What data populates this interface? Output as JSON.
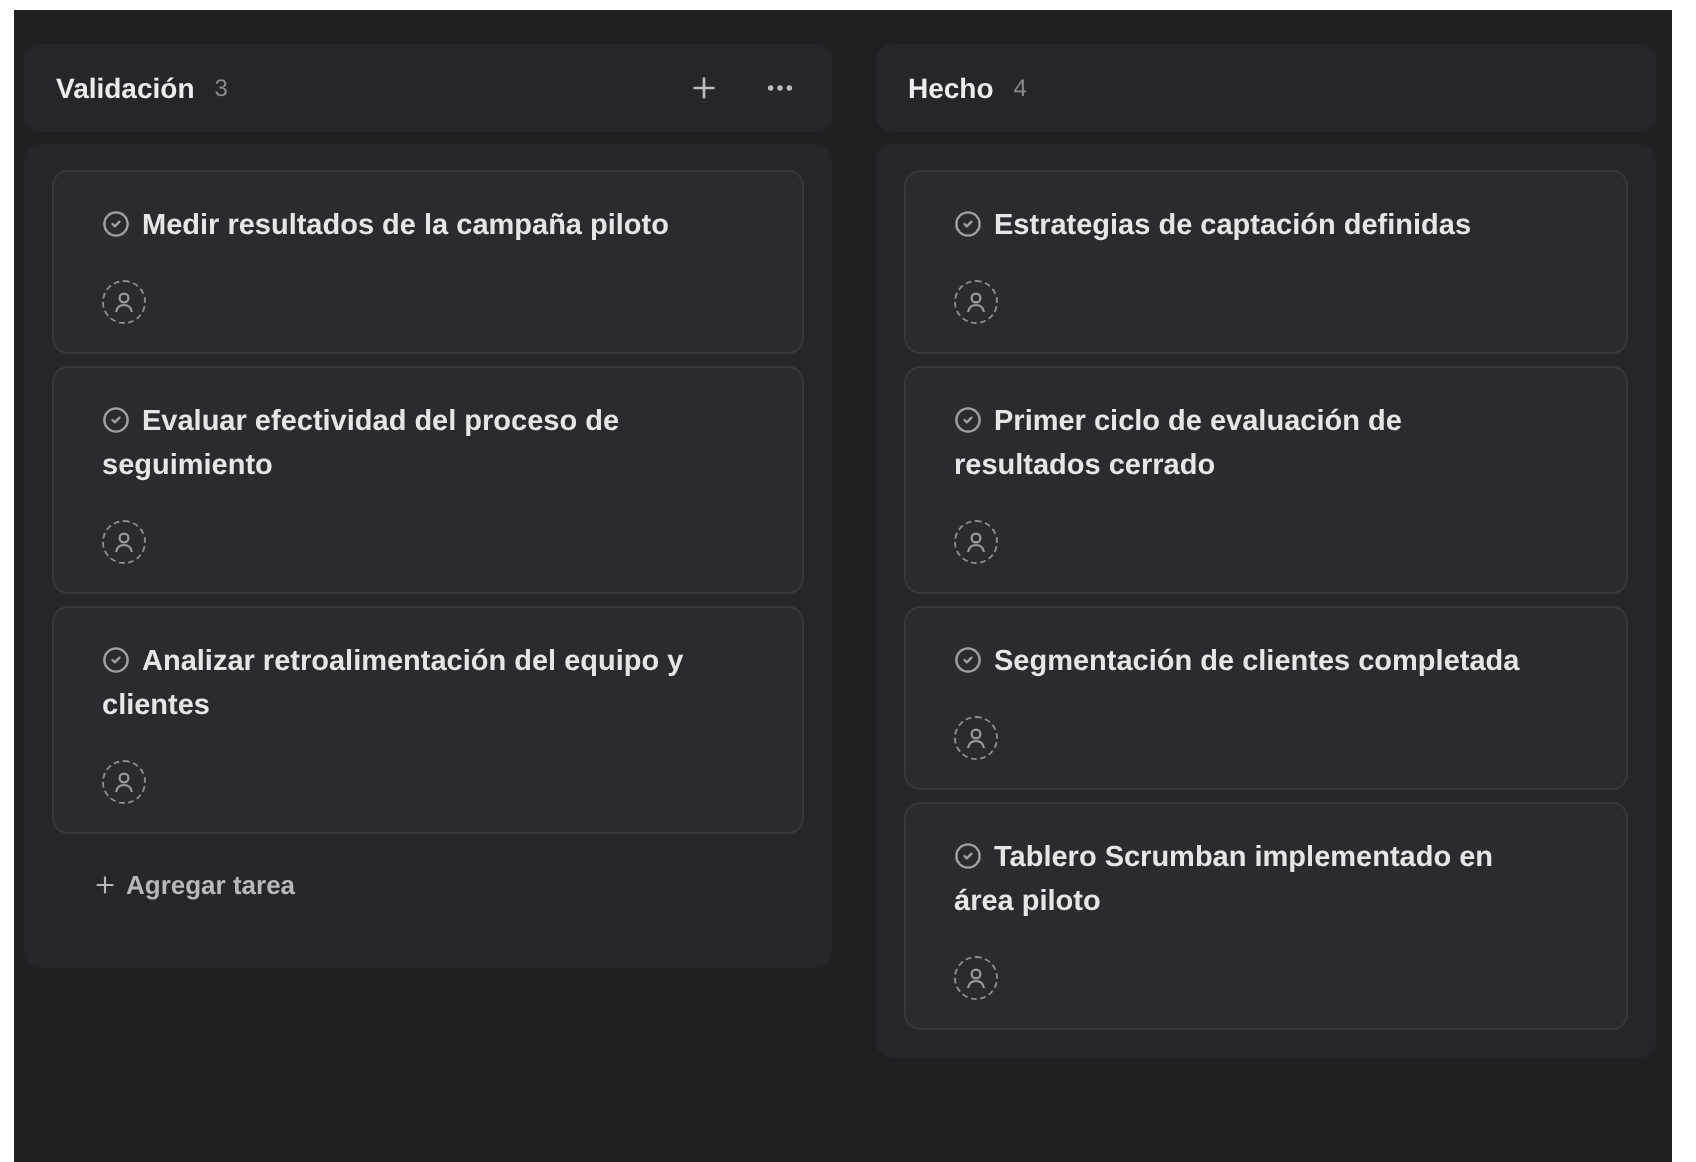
{
  "columns": [
    {
      "title": "Validación",
      "count": "3",
      "header_actions": true,
      "add_task": "Agregar tarea",
      "cards": [
        {
          "title": "Medir resultados de la campaña piloto"
        },
        {
          "title": "Evaluar efectividad del proceso de seguimiento"
        },
        {
          "title": "Analizar retroalimentación del equipo y clientes"
        }
      ]
    },
    {
      "title": "Hecho",
      "count": "4",
      "header_actions": false,
      "cards": [
        {
          "title": "Estrategias de captación definidas"
        },
        {
          "title": "Primer ciclo de evaluación de resultados cerrado"
        },
        {
          "title": "Segmentación de clientes completada"
        },
        {
          "title": "Tablero Scrumban implementado en área piloto"
        }
      ]
    }
  ]
}
